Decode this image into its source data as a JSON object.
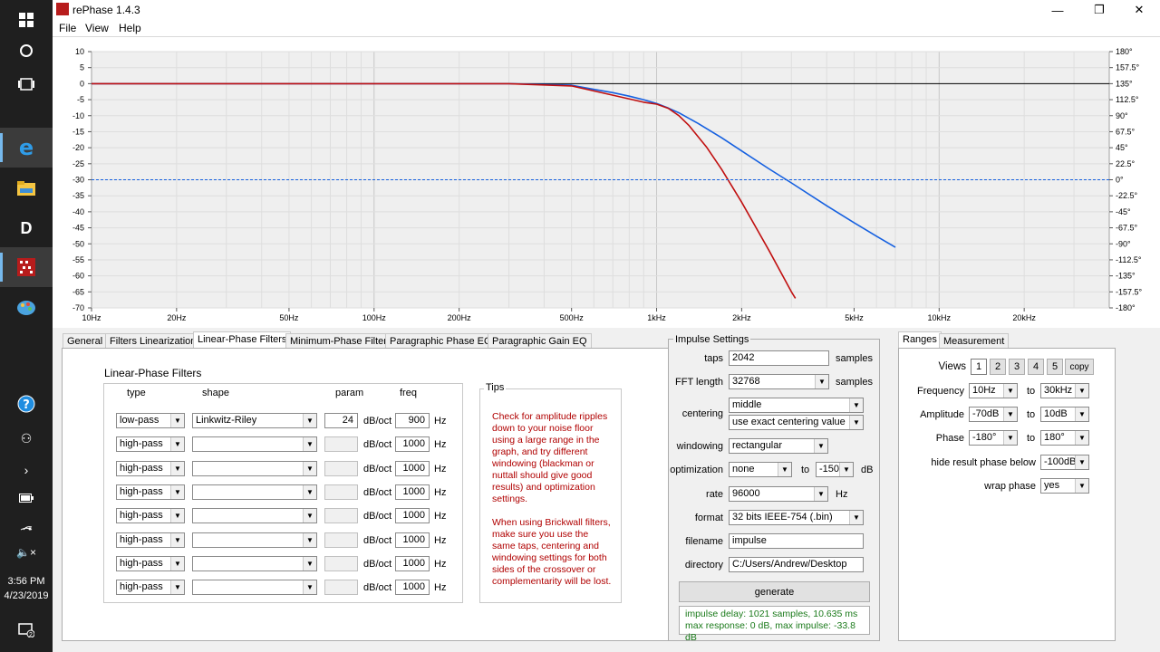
{
  "window": {
    "title": "rePhase 1.4.3"
  },
  "menu": [
    "File",
    "View",
    "Help"
  ],
  "taskbar": {
    "time": "3:56 PM",
    "date": "4/23/2019"
  },
  "chart_data": {
    "type": "line",
    "x_scale": "log",
    "xlim": [
      10,
      40000
    ],
    "xticks": [
      {
        "v": 10,
        "label": "10Hz"
      },
      {
        "v": 20,
        "label": "20Hz"
      },
      {
        "v": 50,
        "label": "50Hz"
      },
      {
        "v": 100,
        "label": "100Hz"
      },
      {
        "v": 200,
        "label": "200Hz"
      },
      {
        "v": 500,
        "label": "500Hz"
      },
      {
        "v": 1000,
        "label": "1kHz"
      },
      {
        "v": 2000,
        "label": "2kHz"
      },
      {
        "v": 5000,
        "label": "5kHz"
      },
      {
        "v": 10000,
        "label": "10kHz"
      },
      {
        "v": 20000,
        "label": "20kHz"
      }
    ],
    "ylim_left": [
      -70,
      10
    ],
    "yticks_left": [
      "10",
      "5",
      "0",
      "-5",
      "-10",
      "-15",
      "-20",
      "-25",
      "-30",
      "-35",
      "-40",
      "-45",
      "-50",
      "-55",
      "-60",
      "-65",
      "-70"
    ],
    "ylim_right": [
      -180,
      180
    ],
    "yticks_right": [
      "180°",
      "157.5°",
      "135°",
      "112.5°",
      "90°",
      "67.5°",
      "45°",
      "22.5°",
      "0°",
      "-22.5°",
      "-45°",
      "-67.5°",
      "-90°",
      "-112.5°",
      "-135°",
      "-157.5°",
      "-180°"
    ],
    "grid": true,
    "series": [
      {
        "color": "#1560e0",
        "x": [
          10,
          300,
          500,
          600,
          700,
          800,
          900,
          1000,
          1100,
          1200,
          1400,
          1700,
          2000,
          2500,
          3000,
          4000,
          5000,
          6000,
          7000
        ],
        "y": [
          0,
          0,
          -0.5,
          -1.8,
          -2.8,
          -3.9,
          -5,
          -6.2,
          -7.6,
          -9.1,
          -12.4,
          -16.9,
          -21,
          -26.6,
          -31,
          -38.1,
          -43.4,
          -47.6,
          -51.1
        ]
      },
      {
        "color": "#c01010",
        "x": [
          10,
          300,
          500,
          700,
          900,
          1000,
          1100,
          1200,
          1300,
          1500,
          1700,
          2000,
          2500,
          3000,
          3100
        ],
        "y": [
          0,
          0,
          -0.7,
          -3.6,
          -5.8,
          -6.4,
          -7.7,
          -10,
          -13,
          -19.7,
          -26.8,
          -37,
          -52.1,
          -65,
          -67
        ]
      },
      {
        "color": "#1560e0",
        "dashed": true,
        "y_right": 0,
        "x": [
          10,
          40000
        ]
      }
    ]
  },
  "tabs": [
    "General",
    "Filters Linearization",
    "Linear-Phase Filters",
    "Minimum-Phase Filters",
    "Paragraphic Phase EQ",
    "Paragraphic Gain EQ"
  ],
  "active_tab": "Linear-Phase Filters",
  "lpf": {
    "heading": "Linear-Phase Filters",
    "col_type": "type",
    "col_shape": "shape",
    "col_param": "param",
    "col_freq": "freq",
    "unit_slope": "dB/oct",
    "unit_hz": "Hz",
    "rows": [
      {
        "type": "low-pass",
        "shape": "Linkwitz-Riley",
        "param": "24",
        "freq": "900"
      },
      {
        "type": "high-pass",
        "shape": "",
        "param": "",
        "freq": "1000"
      },
      {
        "type": "high-pass",
        "shape": "",
        "param": "",
        "freq": "1000"
      },
      {
        "type": "high-pass",
        "shape": "",
        "param": "",
        "freq": "1000"
      },
      {
        "type": "high-pass",
        "shape": "",
        "param": "",
        "freq": "1000"
      },
      {
        "type": "high-pass",
        "shape": "",
        "param": "",
        "freq": "1000"
      },
      {
        "type": "high-pass",
        "shape": "",
        "param": "",
        "freq": "1000"
      },
      {
        "type": "high-pass",
        "shape": "",
        "param": "",
        "freq": "1000"
      }
    ]
  },
  "tips": {
    "title": "Tips",
    "p1": "Check for amplitude ripples\ndown to your noise floor\nusing a large range in the\ngraph, and try different\nwindowing (blackman or\nnuttall should give good\nresults) and optimization\nsettings.",
    "p2": "When using Brickwall filters,\nmake sure you use the\nsame taps, centering and\nwindowing settings for both\nsides of the crossover or\ncomplementarity will be lost."
  },
  "impulse": {
    "title": "Impulse Settings",
    "taps_label": "taps",
    "taps": "2042",
    "samples1": "samples",
    "fft_label": "FFT length",
    "fft": "32768",
    "samples2": "samples",
    "centering_label": "centering",
    "centering1": "middle",
    "centering2": "use exact centering value",
    "windowing_label": "windowing",
    "windowing": "rectangular",
    "optimization_label": "optimization",
    "optimization": "none",
    "opt_to": "to",
    "opt_db_val": "-150",
    "opt_db": "dB",
    "rate_label": "rate",
    "rate": "96000",
    "rate_unit": "Hz",
    "format_label": "format",
    "format": "32 bits IEEE-754 (.bin)",
    "filename_label": "filename",
    "filename": "impulse",
    "directory_label": "directory",
    "directory": "C:/Users/Andrew/Desktop",
    "generate": "generate",
    "status": "impulse delay: 1021 samples, 10.635 ms\nmax response: 0 dB, max impulse: -33.8 dB"
  },
  "ranges": {
    "tabs": [
      "Ranges",
      "Measurement"
    ],
    "views_label": "Views",
    "views": [
      "1",
      "2",
      "3",
      "4",
      "5",
      "copy"
    ],
    "frequency_label": "Frequency",
    "freq_from": "10Hz",
    "freq_to": "30kHz",
    "amplitude_label": "Amplitude",
    "amp_from": "-70dB",
    "amp_to": "10dB",
    "phase_label": "Phase",
    "phase_from": "-180°",
    "phase_to": "180°",
    "hide_label": "hide result phase below",
    "hide_val": "-100dB",
    "wrap_label": "wrap phase",
    "wrap_val": "yes",
    "to": "to"
  }
}
